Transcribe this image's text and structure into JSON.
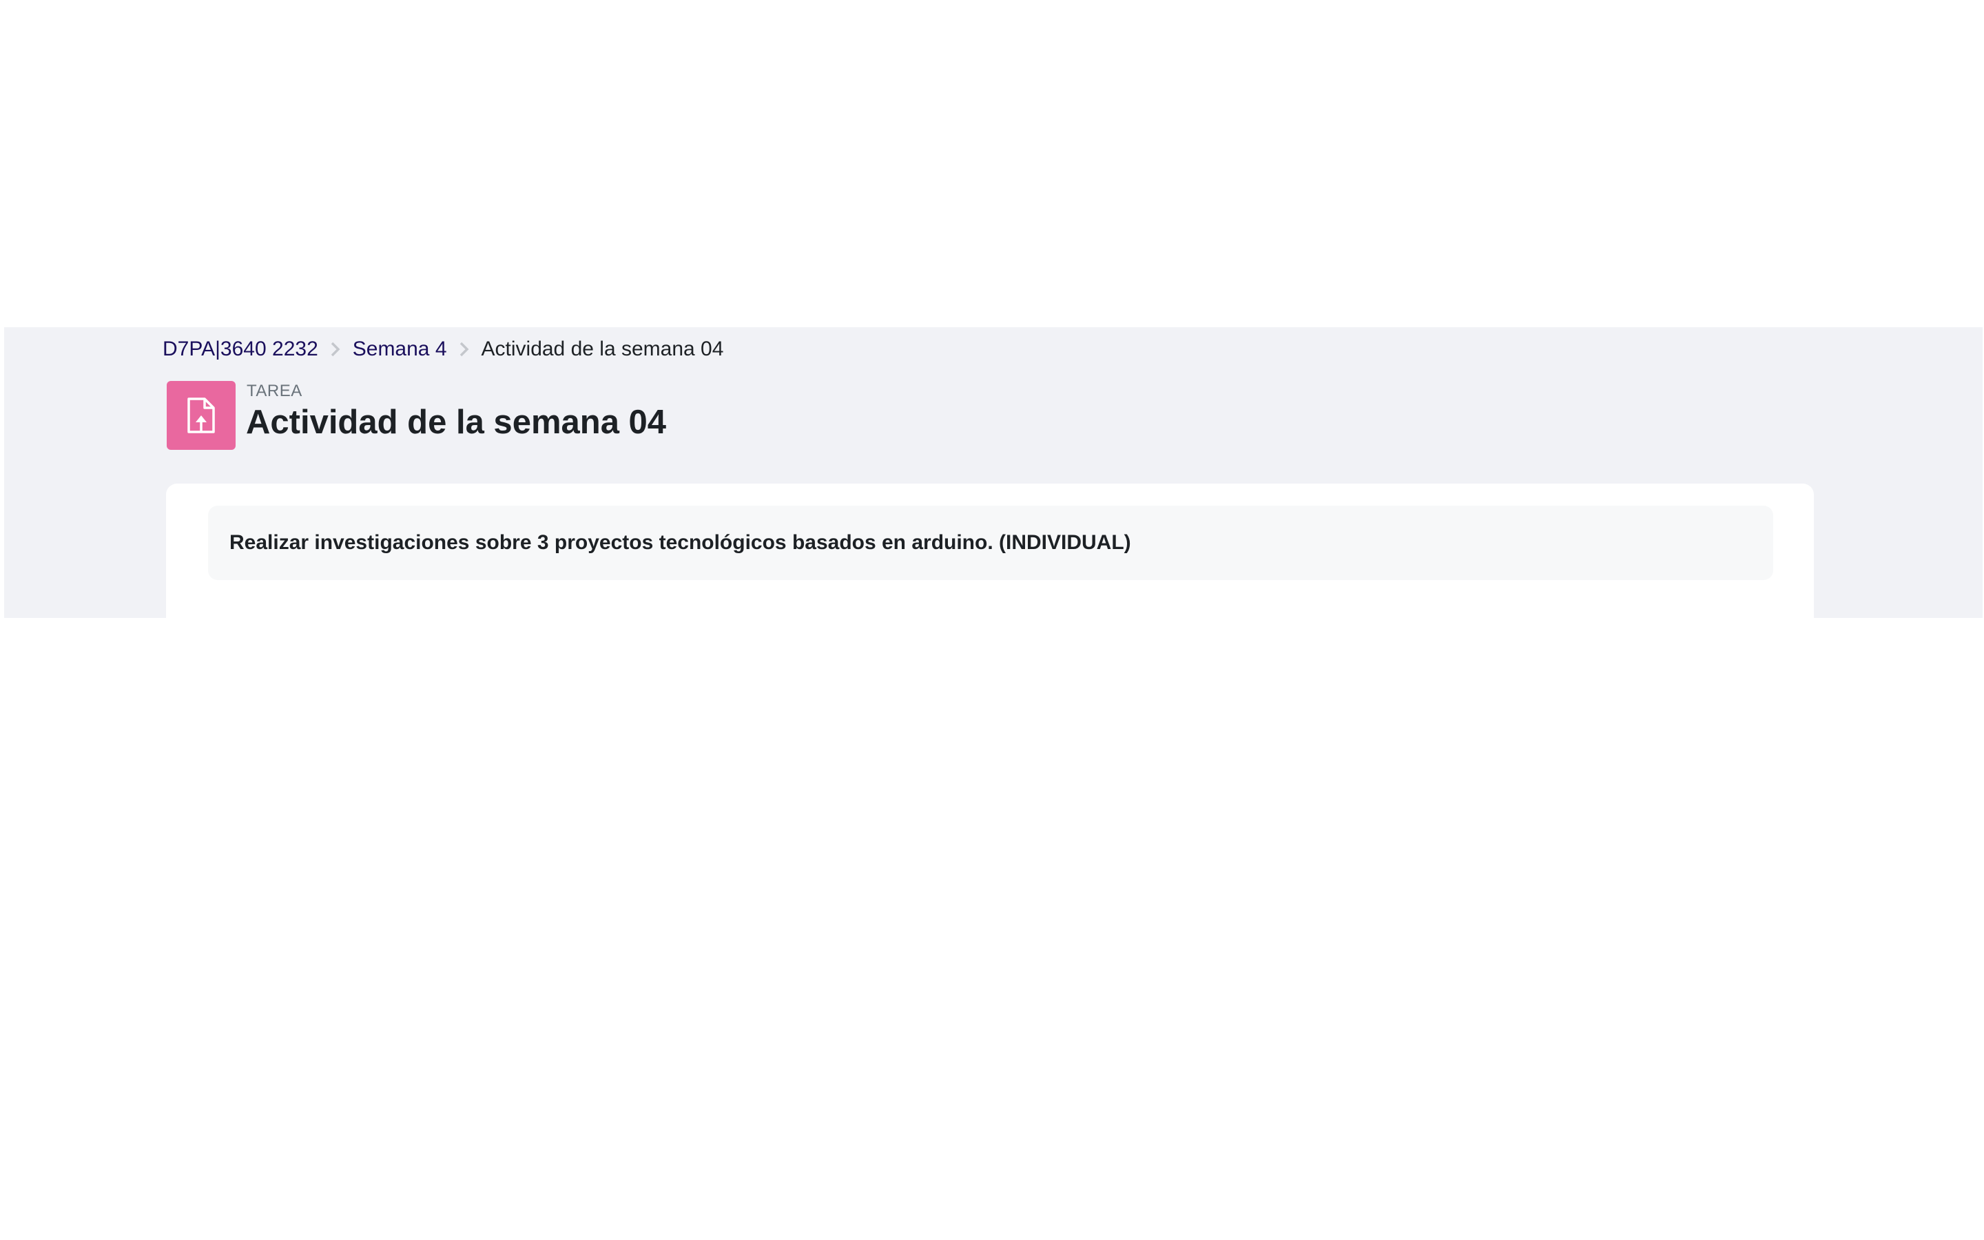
{
  "breadcrumb": {
    "items": [
      {
        "label": "D7PA|3640 2232"
      },
      {
        "label": "Semana 4"
      }
    ],
    "current": "Actividad de la semana 04"
  },
  "activity": {
    "icon": "file-upload-icon",
    "icon_color": "#e9689f",
    "type_label": "TAREA",
    "title": "Actividad de la semana 04"
  },
  "description": {
    "text": "Realizar investigaciones sobre 3 proyectos tecnológicos basados en arduino. (INDIVIDUAL)"
  },
  "colors": {
    "link": "#1a0f5c",
    "page_background": "#f1f2f6",
    "card_background": "#ffffff",
    "description_background": "#f7f8f9"
  }
}
